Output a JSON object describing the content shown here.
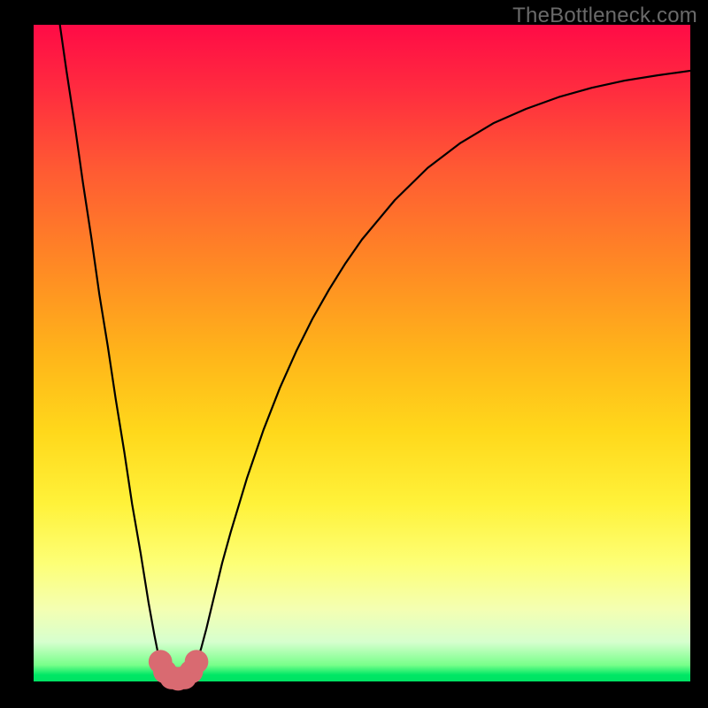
{
  "watermark": "TheBottleneck.com",
  "chart_data": {
    "type": "line",
    "title": "",
    "xlabel": "",
    "ylabel": "",
    "xlim": [
      0,
      100
    ],
    "ylim": [
      0,
      100
    ],
    "grid": false,
    "legend": false,
    "series": [
      {
        "name": "curve",
        "color": "#000000",
        "x": [
          4.0,
          5.0,
          6.3,
          7.5,
          8.8,
          10.0,
          11.3,
          12.5,
          13.8,
          15.0,
          16.3,
          17.5,
          18.4,
          19.0,
          19.5,
          20.0,
          20.8,
          21.6,
          22.4,
          23.1,
          23.9,
          24.7,
          25.0,
          25.5,
          26.3,
          27.5,
          28.7,
          30.0,
          32.5,
          35.0,
          37.5,
          40.0,
          42.5,
          45.0,
          47.5,
          50.0,
          55.0,
          60.0,
          65.0,
          70.0,
          75.0,
          80.0,
          85.0,
          90.0,
          95.0,
          100.0
        ],
        "y": [
          100.0,
          93.0,
          84.5,
          76.0,
          67.5,
          59.0,
          51.0,
          43.0,
          35.0,
          27.0,
          19.5,
          12.0,
          7.0,
          4.0,
          2.3,
          1.2,
          0.6,
          0.2,
          0.2,
          0.6,
          1.3,
          2.6,
          3.5,
          5.0,
          8.0,
          13.0,
          18.0,
          22.7,
          31.0,
          38.3,
          44.7,
          50.3,
          55.3,
          59.7,
          63.7,
          67.3,
          73.3,
          78.2,
          82.0,
          85.0,
          87.2,
          89.0,
          90.4,
          91.5,
          92.3,
          93.0
        ]
      }
    ],
    "markers": [
      {
        "x": 19.3,
        "y": 3.0,
        "r": 1.8,
        "color": "#d96a71"
      },
      {
        "x": 20.0,
        "y": 1.5,
        "r": 1.8,
        "color": "#d96a71"
      },
      {
        "x": 21.0,
        "y": 0.6,
        "r": 1.8,
        "color": "#d96a71"
      },
      {
        "x": 22.0,
        "y": 0.4,
        "r": 1.8,
        "color": "#d96a71"
      },
      {
        "x": 23.0,
        "y": 0.6,
        "r": 1.8,
        "color": "#d96a71"
      },
      {
        "x": 24.0,
        "y": 1.5,
        "r": 1.8,
        "color": "#d96a71"
      },
      {
        "x": 24.8,
        "y": 3.0,
        "r": 1.8,
        "color": "#d96a71"
      }
    ]
  }
}
